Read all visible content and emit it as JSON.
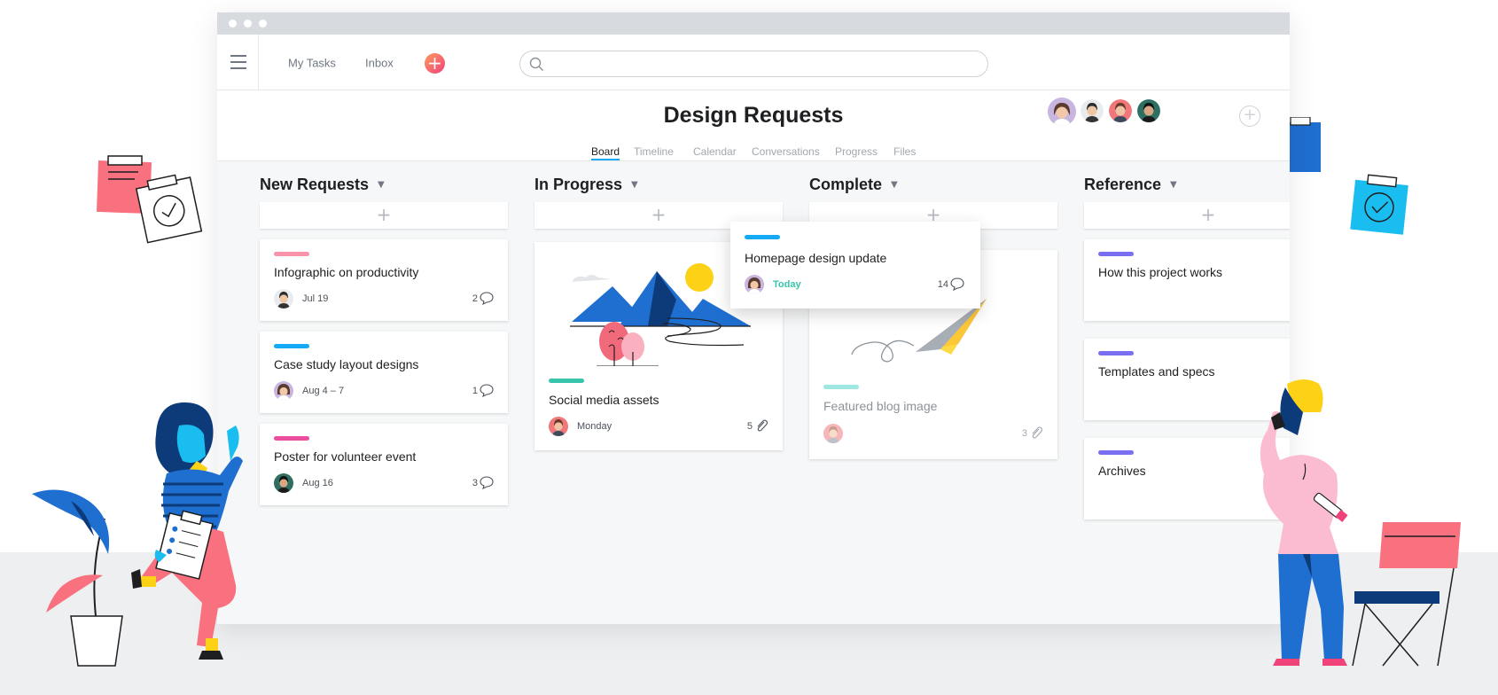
{
  "app": {
    "nav": {
      "my_tasks": "My Tasks",
      "inbox": "Inbox",
      "add_symbol": "+"
    },
    "search": {
      "placeholder": ""
    }
  },
  "project": {
    "title": "Design Requests",
    "tabs": [
      "Board",
      "Timeline",
      "Calendar",
      "Conversations",
      "Progress",
      "Files"
    ],
    "active_tab": "Board",
    "add_member_symbol": "+"
  },
  "board": {
    "add_symbol": "+",
    "columns": [
      {
        "name": "New Requests",
        "cards": [
          {
            "title": "Infographic on productivity",
            "date": "Jul 19",
            "count": "2",
            "count_icon": "comment-icon",
            "tag_color": "#f993aa"
          },
          {
            "title": "Case study layout designs",
            "date": "Aug 4 – 7",
            "count": "1",
            "count_icon": "comment-icon",
            "tag_color": "#14aaf5"
          },
          {
            "title": "Poster for volunteer event",
            "date": "Aug 16",
            "count": "3",
            "count_icon": "comment-icon",
            "tag_color": "#ea4e9d"
          }
        ]
      },
      {
        "name": "In Progress",
        "cards": [
          {
            "title": "Social media assets",
            "date": "Monday",
            "count": "5",
            "count_icon": "paperclip-icon",
            "tag_color": "#37c5ab"
          }
        ]
      },
      {
        "name": "Complete",
        "cards": [
          {
            "title": "Featured blog image",
            "date": "",
            "count": "3",
            "count_icon": "paperclip-icon",
            "tag_color": "#9ee7e3"
          }
        ]
      },
      {
        "name": "Reference",
        "cards": [
          {
            "title": "How this project works",
            "tag_color": "#7a6ff0"
          },
          {
            "title": "Templates and specs",
            "tag_color": "#7a6ff0"
          },
          {
            "title": "Archives",
            "tag_color": "#7a6ff0"
          }
        ]
      }
    ],
    "dragging_card": {
      "title": "Homepage design update",
      "date": "Today",
      "count": "14",
      "count_icon": "comment-icon",
      "tag_color": "#14aaf5",
      "date_color": "#37c5ab"
    }
  },
  "colors": {
    "accent_blue": "#14aaf5",
    "add_button_gradient": [
      "#fc9a5e",
      "#f0437a"
    ],
    "title_text": "#1e1f21",
    "muted_text": "#a2a8ae"
  }
}
